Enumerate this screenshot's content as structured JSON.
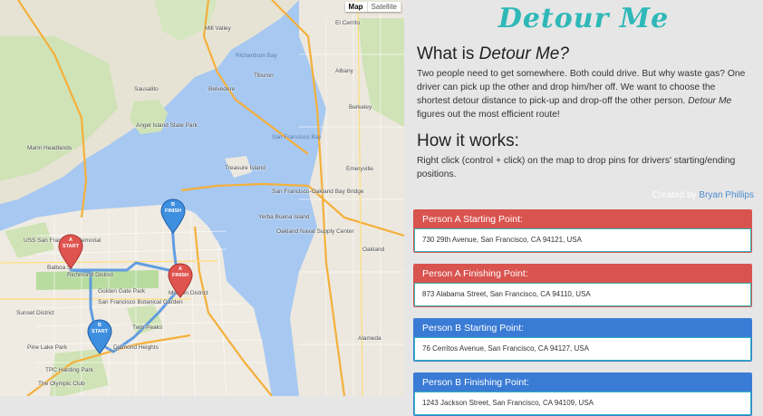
{
  "map": {
    "toggle": {
      "map_label": "Map",
      "satellite_label": "Satellite"
    },
    "labels": {
      "sausalito": "Sausalito",
      "mill_valley": "Mill Valley",
      "belvedere": "Belvedere",
      "tiburon": "Tiburon",
      "alameda": "Alameda",
      "el_cerrito": "El Cerrito",
      "albany": "Albany",
      "berkeley": "Berkeley",
      "emeryville": "Emeryville",
      "oakland": "Oakland",
      "treasure_island": "Treasure Island",
      "yerba_buena": "Yerba Buena Island",
      "angel_island": "Angel Island State Park",
      "marin_headlands": "Marin Headlands",
      "san_francisco_bay": "San Francisco Bay",
      "richardson_bay": "Richardson Bay",
      "golden_gate_park": "Golden Gate Park",
      "richmond_district": "Richmond District",
      "sunset_district": "Sunset District",
      "mission_district": "Mission District",
      "twin_peaks": "Twin Peaks",
      "diamond_heights": "Diamond Heights",
      "tpc_harding": "TPC Harding Park",
      "olympic_club": "The Olympic Club",
      "pine_lake": "Pine Lake Park",
      "sf_memorial": "USS San Francisco Memorial",
      "oakland_naval": "Oakland Naval Supply Center",
      "sf_botanical": "San Francisco Botanical Garden",
      "bay_bridge": "San Francisco-Oakland Bay Bridge",
      "balboa_st": "Balboa St"
    },
    "pins": {
      "a_start": {
        "line1": "A",
        "line2": "START"
      },
      "a_finish": {
        "line1": "A",
        "line2": "FINISH"
      },
      "b_start": {
        "line1": "B",
        "line2": "START"
      },
      "b_finish": {
        "line1": "B",
        "line2": "FINISH"
      }
    }
  },
  "brand": {
    "title": "Detour Me"
  },
  "about": {
    "heading_prefix": "What is ",
    "heading_em": "Detour Me?",
    "text_1": "Two people need to get somewhere. Both could drive. But why waste gas? One driver can pick up the other and drop him/her off. We want to choose the shortest detour distance to pick-up and drop-off the other person. ",
    "text_em": "Detour Me",
    "text_2": " figures out the most efficient route!"
  },
  "how": {
    "heading": "How it works:",
    "text": "Right click (control + click) on the map to drop pins for drivers' starting/ending positions."
  },
  "credit": {
    "prefix": "Created by ",
    "author": "Bryan Phillips"
  },
  "cards": [
    {
      "title": "Person A Starting Point:",
      "address": "730 29th Avenue, San Francisco, CA 94121, USA"
    },
    {
      "title": "Person A Finishing Point:",
      "address": "873 Alabama Street, San Francisco, CA 94110, USA"
    },
    {
      "title": "Person B Starting Point:",
      "address": "76 Cerritos Avenue, San Francisco, CA 94127, USA"
    },
    {
      "title": "Person B Finishing Point:",
      "address": "1243 Jackson Street, San Francisco, CA 94109, USA"
    }
  ],
  "colors": {
    "brand": "#2fb8b8",
    "person_a": "#d9534f",
    "person_b": "#3a7bd5",
    "route": "#4a90e2",
    "water": "#a7c8f1",
    "land": "#efebe2"
  }
}
